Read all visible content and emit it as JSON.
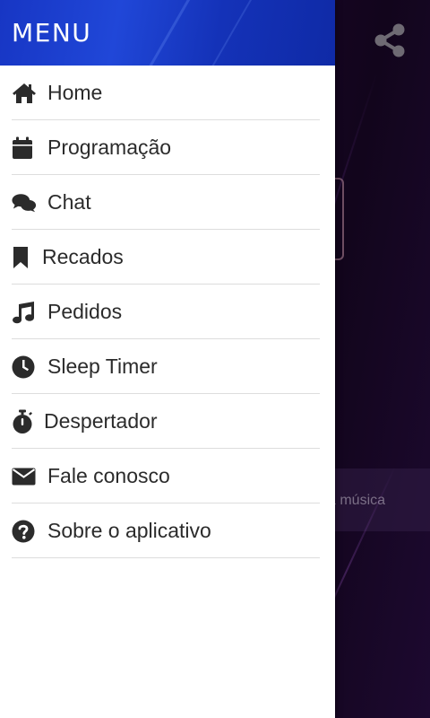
{
  "drawer": {
    "title": "MENU",
    "items": [
      {
        "label": "Home",
        "icon": "home-icon"
      },
      {
        "label": "Programação",
        "icon": "calendar-icon"
      },
      {
        "label": "Chat",
        "icon": "chat-icon"
      },
      {
        "label": "Recados",
        "icon": "bookmark-icon"
      },
      {
        "label": "Pedidos",
        "icon": "music-note-icon"
      },
      {
        "label": "Sleep Timer",
        "icon": "clock-icon"
      },
      {
        "label": "Despertador",
        "icon": "stopwatch-icon"
      },
      {
        "label": "Fale conosco",
        "icon": "envelope-icon"
      },
      {
        "label": "Sobre o aplicativo",
        "icon": "question-circle-icon"
      }
    ]
  },
  "background": {
    "info_text": "a música",
    "share_icon": "share-icon"
  },
  "colors": {
    "header": "#1f44d4",
    "text": "#2b2b2b",
    "icon": "#2b2b2b"
  }
}
